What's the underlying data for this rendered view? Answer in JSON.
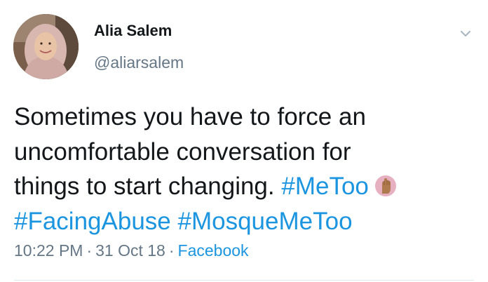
{
  "author": {
    "display_name": "Alia Salem",
    "handle": "@aliarsalem",
    "avatar": "profile-photo"
  },
  "menu": {
    "icon": "chevron-down-icon"
  },
  "tweet": {
    "line1": "Sometimes you have to force an",
    "line2": "uncomfortable conversation for",
    "line3_text": "things to start changing.",
    "hashtag1": "#MeToo",
    "emoji": "raised-fist-emoji",
    "hashtag2": "#FacingAbuse",
    "hashtag3": "#MosqueMeToo"
  },
  "meta": {
    "time": "10:22 PM",
    "separator": "·",
    "date": "31 Oct 18",
    "source": "Facebook"
  },
  "colors": {
    "link": "#1b95e0",
    "text": "#14171a",
    "secondary": "#657786"
  }
}
